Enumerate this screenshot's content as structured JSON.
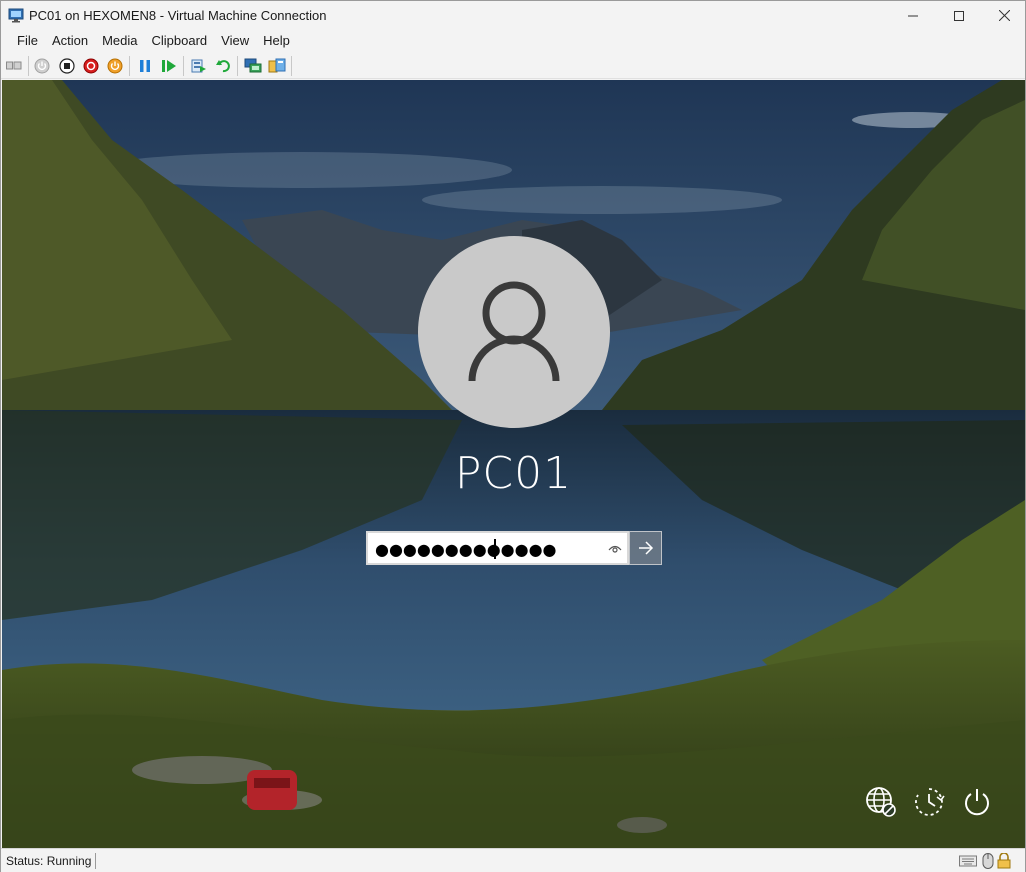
{
  "window": {
    "title": "PC01 on HEXOMEN8 - Virtual Machine Connection",
    "controls": {
      "minimize": "—",
      "maximize": "☐",
      "close": "✕"
    }
  },
  "menu": [
    {
      "label": "File"
    },
    {
      "label": "Action"
    },
    {
      "label": "Media"
    },
    {
      "label": "Clipboard"
    },
    {
      "label": "View"
    },
    {
      "label": "Help"
    }
  ],
  "toolbar": {
    "icons": [
      "ctrl-alt-del-icon",
      "start-icon",
      "turn-off-icon",
      "shut-down-icon",
      "save-icon",
      "pause-icon",
      "resume-icon",
      "checkpoint-icon",
      "revert-icon",
      "enhanced-session-icon",
      "share-icon"
    ]
  },
  "login": {
    "username": "PC01",
    "password_masked": "●●●●●●●●●●●●●",
    "submit_glyph": "→"
  },
  "statusbar": {
    "status": "Status: Running"
  },
  "colors": {
    "chrome": "#f3f3f3",
    "avatar_bg": "#c9c9c9",
    "avatar_fg": "#3a3a3a",
    "submit_bg": "#7a828c"
  }
}
